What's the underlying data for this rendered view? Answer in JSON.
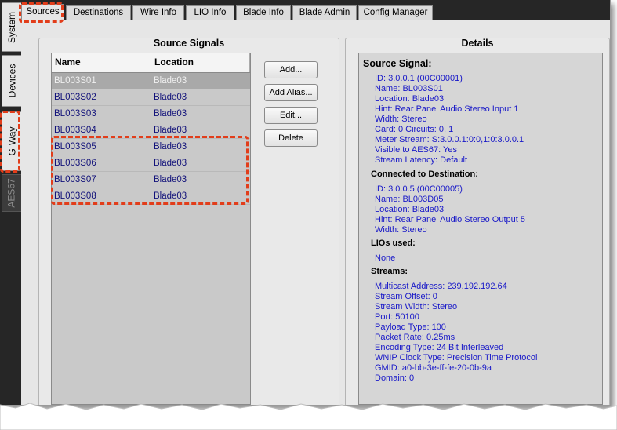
{
  "side_tabs": [
    {
      "label": "System"
    },
    {
      "label": "Devices"
    },
    {
      "label": "G-Way"
    },
    {
      "label": "AES67"
    }
  ],
  "top_tabs": [
    {
      "label": "Sources"
    },
    {
      "label": "Destinations"
    },
    {
      "label": "Wire Info"
    },
    {
      "label": "LIO Info"
    },
    {
      "label": "Blade Info"
    },
    {
      "label": "Blade Admin"
    },
    {
      "label": "Config Manager"
    }
  ],
  "source_panel": {
    "title": "Source Signals",
    "columns": [
      "Name",
      "Location"
    ],
    "rows": [
      {
        "name": "BL003S01",
        "location": "Blade03"
      },
      {
        "name": "BL003S02",
        "location": "Blade03"
      },
      {
        "name": "BL003S03",
        "location": "Blade03"
      },
      {
        "name": "BL003S04",
        "location": "Blade03"
      },
      {
        "name": "BL003S05",
        "location": "Blade03"
      },
      {
        "name": "BL003S06",
        "location": "Blade03"
      },
      {
        "name": "BL003S07",
        "location": "Blade03"
      },
      {
        "name": "BL003S08",
        "location": "Blade03"
      }
    ]
  },
  "actions": {
    "add": "Add...",
    "add_alias": "Add Alias...",
    "edit": "Edit...",
    "delete": "Delete"
  },
  "details": {
    "title": "Details",
    "source_heading": "Source Signal:",
    "source_lines": [
      "ID: 3.0.0.1 (00C00001)",
      "Name: BL003S01",
      "Location: Blade03",
      "Hint: Rear Panel Audio Stereo Input 1",
      "Width: Stereo",
      "Card: 0 Circuits: 0, 1",
      "Meter Stream: S:3.0.0.1:0:0,1:0:3.0.0.1",
      "Visible to AES67: Yes",
      "Stream Latency: Default"
    ],
    "dest_heading": "Connected to Destination:",
    "dest_lines": [
      "ID: 3.0.0.5 (00C00005)",
      "Name: BL003D05",
      "Location: Blade03",
      "Hint: Rear Panel Audio Stereo Output 5",
      "Width: Stereo"
    ],
    "lio_heading": "LIOs used:",
    "lio_lines": [
      "None"
    ],
    "streams_heading": "Streams:",
    "stream_lines": [
      "Multicast Address: 239.192.192.64",
      "Stream Offset: 0",
      "Stream Width: Stereo",
      "Port: 50100",
      "Payload Type: 100",
      "Packet Rate: 0.25ms",
      "Encoding Type: 24 Bit Interleaved",
      "WNIP Clock Type: Precision Time Protocol",
      "GMID: a0-bb-3e-ff-fe-20-0b-9a",
      "Domain: 0"
    ]
  },
  "colors": {
    "highlight": "#e23d1a",
    "value_text": "#1818c8",
    "list_text": "#12127a"
  }
}
